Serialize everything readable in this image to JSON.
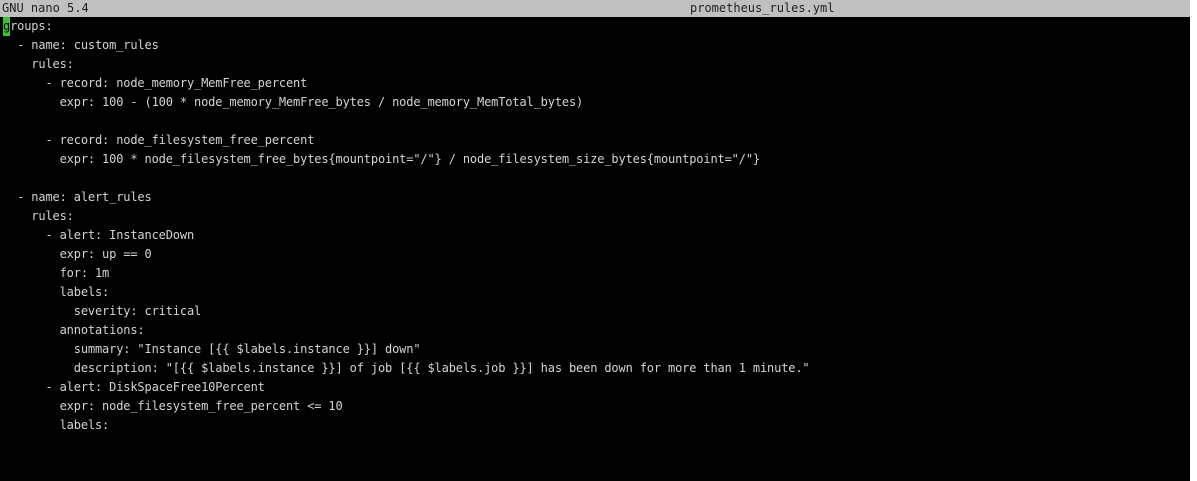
{
  "titlebar": {
    "app_version": "GNU nano 5.4",
    "file_name": "prometheus_rules.yml"
  },
  "editor": {
    "cursor_char": "g",
    "first_line_rest": "roups:",
    "lines": [
      "  - name: custom_rules",
      "    rules:",
      "      - record: node_memory_MemFree_percent",
      "        expr: 100 - (100 * node_memory_MemFree_bytes / node_memory_MemTotal_bytes)",
      "",
      "      - record: node_filesystem_free_percent",
      "        expr: 100 * node_filesystem_free_bytes{mountpoint=\"/\"} / node_filesystem_size_bytes{mountpoint=\"/\"}",
      "",
      "  - name: alert_rules",
      "    rules:",
      "      - alert: InstanceDown",
      "        expr: up == 0",
      "        for: 1m",
      "        labels:",
      "          severity: critical",
      "        annotations:",
      "          summary: \"Instance [{{ $labels.instance }}] down\"",
      "          description: \"[{{ $labels.instance }}] of job [{{ $labels.job }}] has been down for more than 1 minute.\"",
      "      - alert: DiskSpaceFree10Percent",
      "        expr: node_filesystem_free_percent <= 10",
      "        labels:"
    ]
  }
}
